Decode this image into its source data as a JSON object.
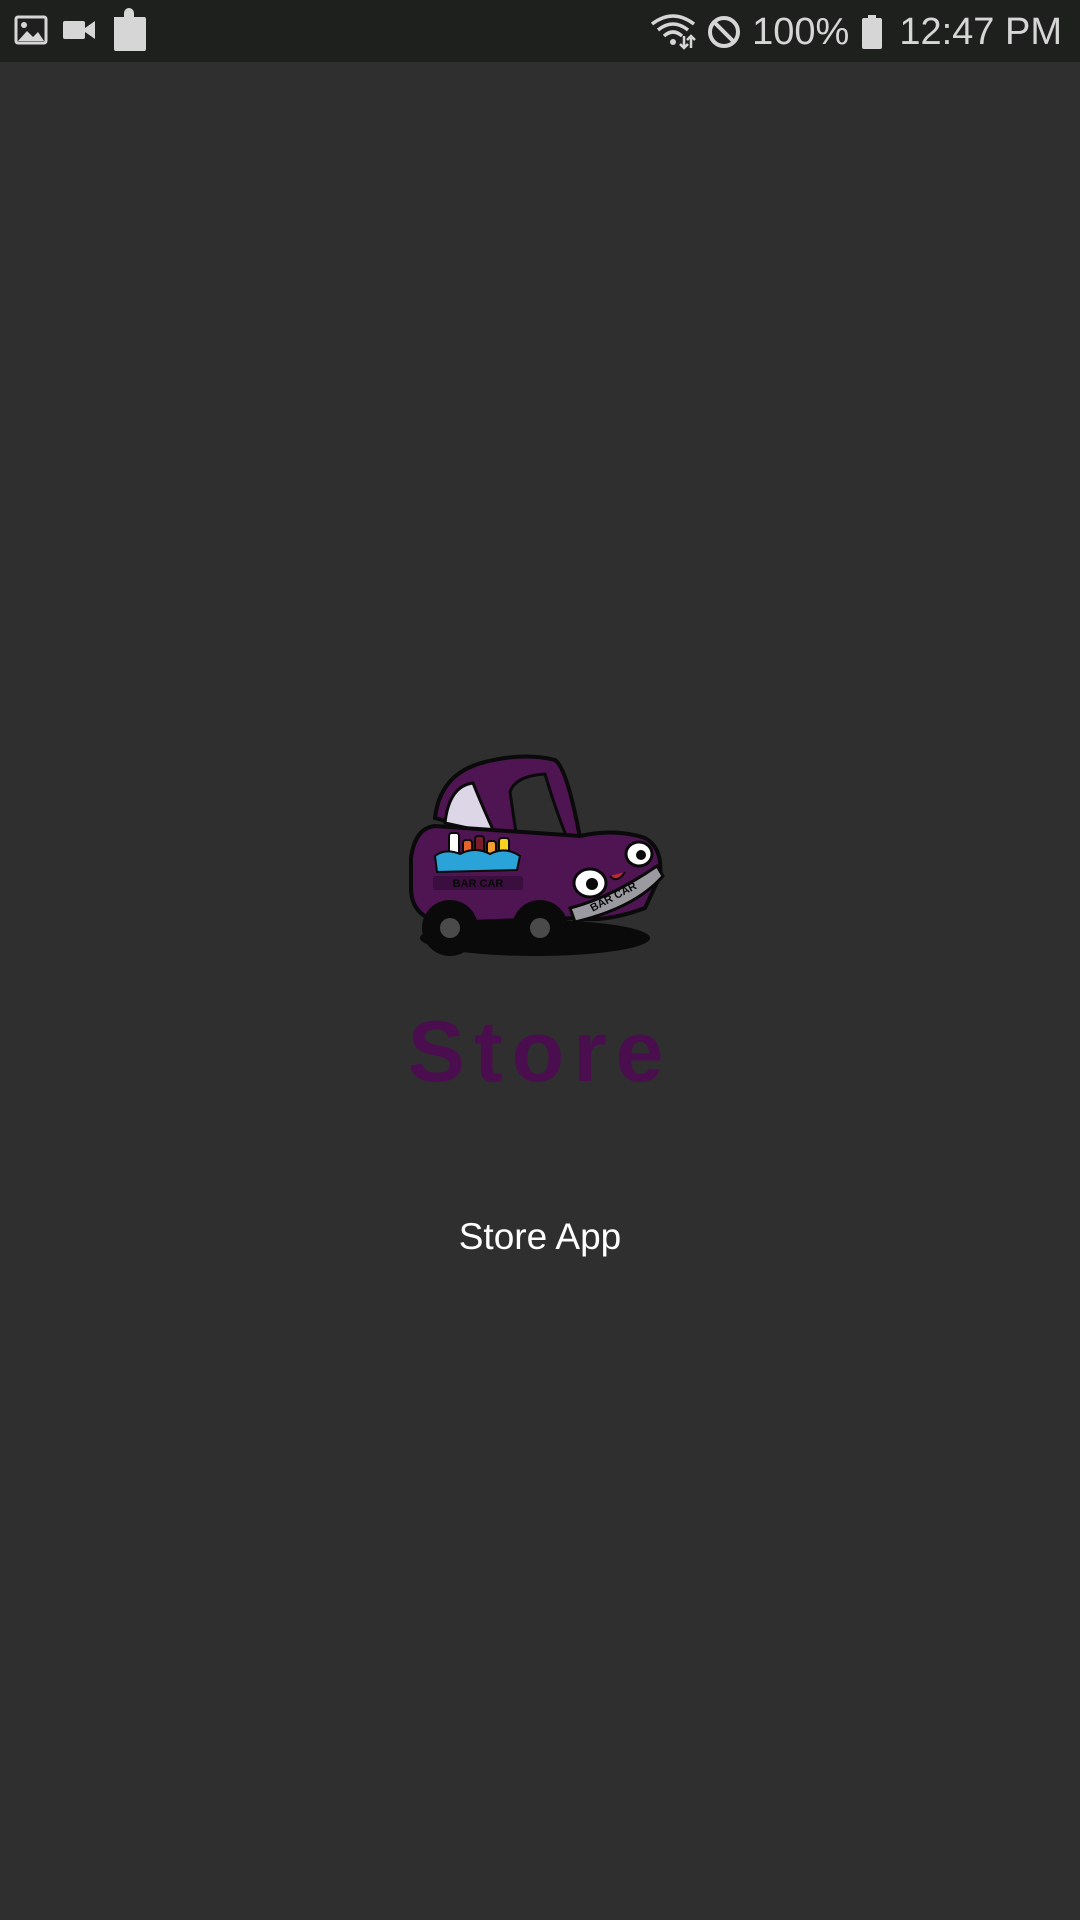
{
  "status_bar": {
    "left_icons": [
      "gallery-icon",
      "video-camera-icon",
      "puzzle-piece-icon"
    ],
    "right_icons": [
      "wifi-icon",
      "do-not-disturb-icon",
      "battery-icon"
    ],
    "battery_percent": "100%",
    "time": "12:47 PM"
  },
  "splash": {
    "logo": {
      "icon": "bar-car-logo",
      "label_text": "BAR CAR"
    },
    "brand_text": "Store",
    "subtitle": "Store App"
  },
  "colors": {
    "background": "#2f2f2f",
    "status_bar": "#1e201e",
    "brand": "#4a0e4e",
    "car_body": "#4f1553",
    "subtitle_text": "#ffffff"
  }
}
